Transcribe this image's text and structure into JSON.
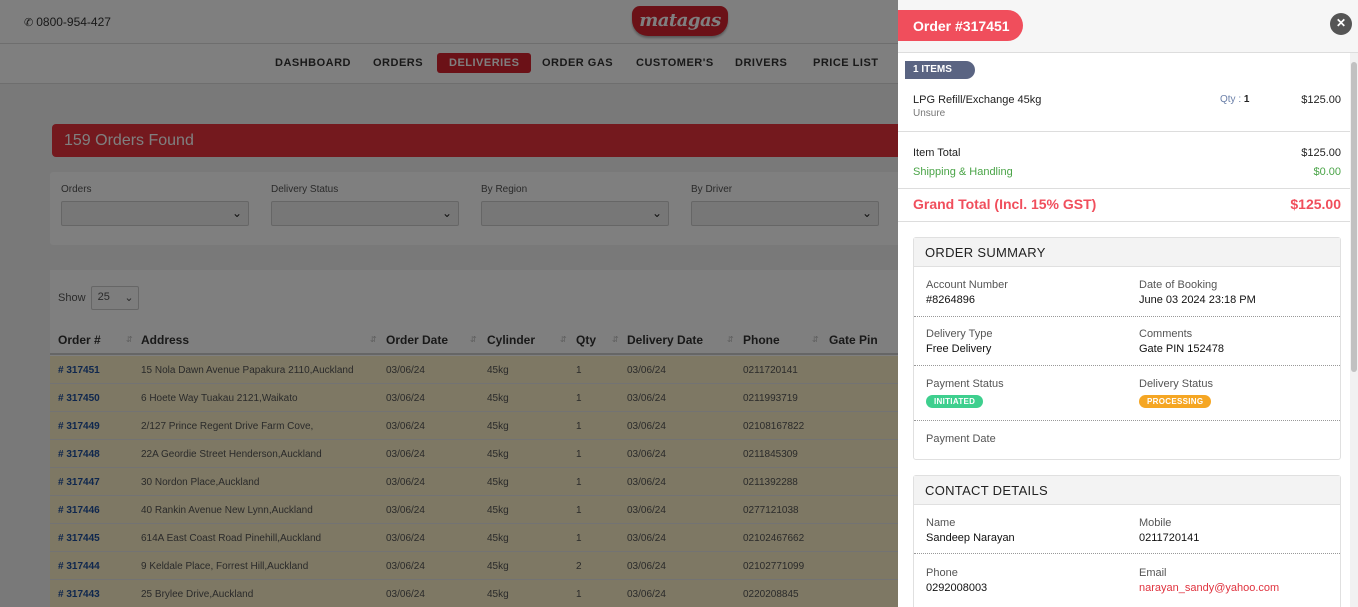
{
  "header": {
    "phone": "0800-954-427",
    "logo_text": "matagas",
    "brand_color": "#d7232f"
  },
  "nav": {
    "items": [
      {
        "label": "DASHBOARD",
        "active": false
      },
      {
        "label": "ORDERS",
        "active": false
      },
      {
        "label": "DELIVERIES",
        "active": true
      },
      {
        "label": "ORDER GAS",
        "active": false
      },
      {
        "label": "CUSTOMER'S",
        "active": false
      },
      {
        "label": "DRIVERS",
        "active": false
      },
      {
        "label": "PRICE LIST",
        "active": false
      }
    ]
  },
  "results": {
    "title": "159 Orders Found"
  },
  "filters": [
    {
      "label": "Orders",
      "value": ""
    },
    {
      "label": "Delivery Status",
      "value": ""
    },
    {
      "label": "By Region",
      "value": ""
    },
    {
      "label": "By Driver",
      "value": ""
    }
  ],
  "table": {
    "show_label": "Show",
    "page_size": "25",
    "columns": [
      "Order #",
      "Address",
      "Order Date",
      "Cylinder",
      "Qty",
      "Delivery Date",
      "Phone",
      "Gate Pin"
    ],
    "rows": [
      [
        "# 317451",
        "15 Nola Dawn Avenue Papakura 2110,Auckland",
        "03/06/24",
        "45kg",
        "1",
        "03/06/24",
        "0211720141",
        ""
      ],
      [
        "# 317450",
        "6 Hoete Way Tuakau 2121,Waikato",
        "03/06/24",
        "45kg",
        "1",
        "03/06/24",
        "0211993719",
        ""
      ],
      [
        "# 317449",
        "2/127 Prince Regent Drive Farm Cove,",
        "03/06/24",
        "45kg",
        "1",
        "03/06/24",
        "02108167822",
        ""
      ],
      [
        "# 317448",
        "22A Geordie Street Henderson,Auckland",
        "03/06/24",
        "45kg",
        "1",
        "03/06/24",
        "0211845309",
        ""
      ],
      [
        "# 317447",
        "30 Nordon Place,Auckland",
        "03/06/24",
        "45kg",
        "1",
        "03/06/24",
        "0211392288",
        ""
      ],
      [
        "# 317446",
        "40 Rankin Avenue New Lynn,Auckland",
        "03/06/24",
        "45kg",
        "1",
        "03/06/24",
        "0277121038",
        ""
      ],
      [
        "# 317445",
        "614A East Coast Road Pinehill,Auckland",
        "03/06/24",
        "45kg",
        "1",
        "03/06/24",
        "02102467662",
        ""
      ],
      [
        "# 317444",
        "9 Keldale Place, Forrest Hill,Auckland",
        "03/06/24",
        "45kg",
        "2",
        "03/06/24",
        "02102771099",
        ""
      ],
      [
        "# 317443",
        "25 Brylee Drive,Auckland",
        "03/06/24",
        "45kg",
        "1",
        "03/06/24",
        "0220208845",
        ""
      ]
    ]
  },
  "panel": {
    "order_title": "Order #317451",
    "items_badge": "1 ITEMS",
    "item": {
      "name": "LPG Refill/Exchange 45kg",
      "sub": "Unsure",
      "qty_label": "Qty :",
      "qty": "1",
      "price": "$125.00"
    },
    "totals": {
      "item_total_label": "Item Total",
      "item_total": "$125.00",
      "shipping_label": "Shipping & Handling",
      "shipping": "$0.00",
      "grand_label": "Grand Total (Incl. 15% GST)",
      "grand": "$125.00"
    },
    "summary": {
      "title": "ORDER SUMMARY",
      "account_label": "Account Number",
      "account": "#8264896",
      "booking_label": "Date of Booking",
      "booking": "June 03 2024 23:18 PM",
      "delivery_type_label": "Delivery Type",
      "delivery_type": "Free Delivery",
      "comments_label": "Comments",
      "comments": "Gate PIN 152478",
      "payment_status_label": "Payment Status",
      "payment_status": "INITIATED",
      "delivery_status_label": "Delivery Status",
      "delivery_status": "PROCESSING",
      "payment_date_label": "Payment Date",
      "payment_date": ""
    },
    "contact": {
      "title": "CONTACT DETAILS",
      "name_label": "Name",
      "name": "Sandeep Narayan",
      "mobile_label": "Mobile",
      "mobile": "0211720141",
      "phone_label": "Phone",
      "phone": "0292008003",
      "email_label": "Email",
      "email": "narayan_sandy@yahoo.com"
    }
  }
}
